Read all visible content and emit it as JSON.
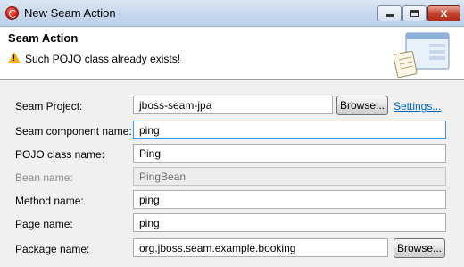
{
  "window": {
    "title": "New Seam Action",
    "minimize_label": "",
    "maximize_label": "",
    "close_label": "x"
  },
  "banner": {
    "title": "Seam Action",
    "message": "Such POJO class already exists!",
    "warning_icon_glyph": "!"
  },
  "form": {
    "seam_project": {
      "label": "Seam Project:",
      "value": "jboss-seam-jpa",
      "browse_label": "Browse...",
      "settings_label": "Settings..."
    },
    "seam_component_name": {
      "label": "Seam component name:",
      "value": "ping"
    },
    "pojo_class_name": {
      "label": "POJO class name:",
      "value": "Ping"
    },
    "bean_name": {
      "label": "Bean name:",
      "value": "PingBean"
    },
    "method_name": {
      "label": "Method name:",
      "value": "ping"
    },
    "page_name": {
      "label": "Page name:",
      "value": "ping"
    },
    "package_name": {
      "label": "Package name:",
      "value": "org.jboss.seam.example.booking",
      "browse_label": "Browse..."
    }
  },
  "colors": {
    "link": "#0066cc",
    "focus_border": "#3399ff",
    "warning": "#f0b400",
    "close_button": "#c4432f"
  }
}
